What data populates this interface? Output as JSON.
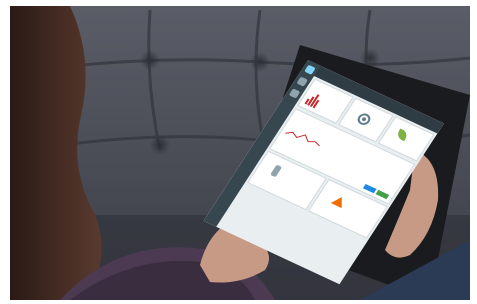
{
  "photo": {
    "subject": "tablet-on-couch",
    "colors": {
      "couch": "#4a4d57",
      "couch_dark": "#2f3139",
      "hair": "#3a2620",
      "skin": "#c79a86",
      "sleeve": "#4b3a52",
      "tablet_body": "#1a1b1e",
      "screen_bg": "#e9eef1",
      "accent_red": "#c62828",
      "accent_green": "#43a047",
      "accent_blue": "#1e88e5"
    }
  },
  "tablet_screen": {
    "sidebar_icons": [
      "home-icon",
      "chart-icon",
      "doc-icon"
    ],
    "tiles": [
      {
        "icon": "bar-chart-icon"
      },
      {
        "icon": "settings-icon"
      },
      {
        "icon": "leaf-icon"
      }
    ],
    "panel": {},
    "bottom_cells": [
      {
        "icon": "cylinder-icon"
      },
      {
        "icon": "warning-icon"
      }
    ]
  }
}
